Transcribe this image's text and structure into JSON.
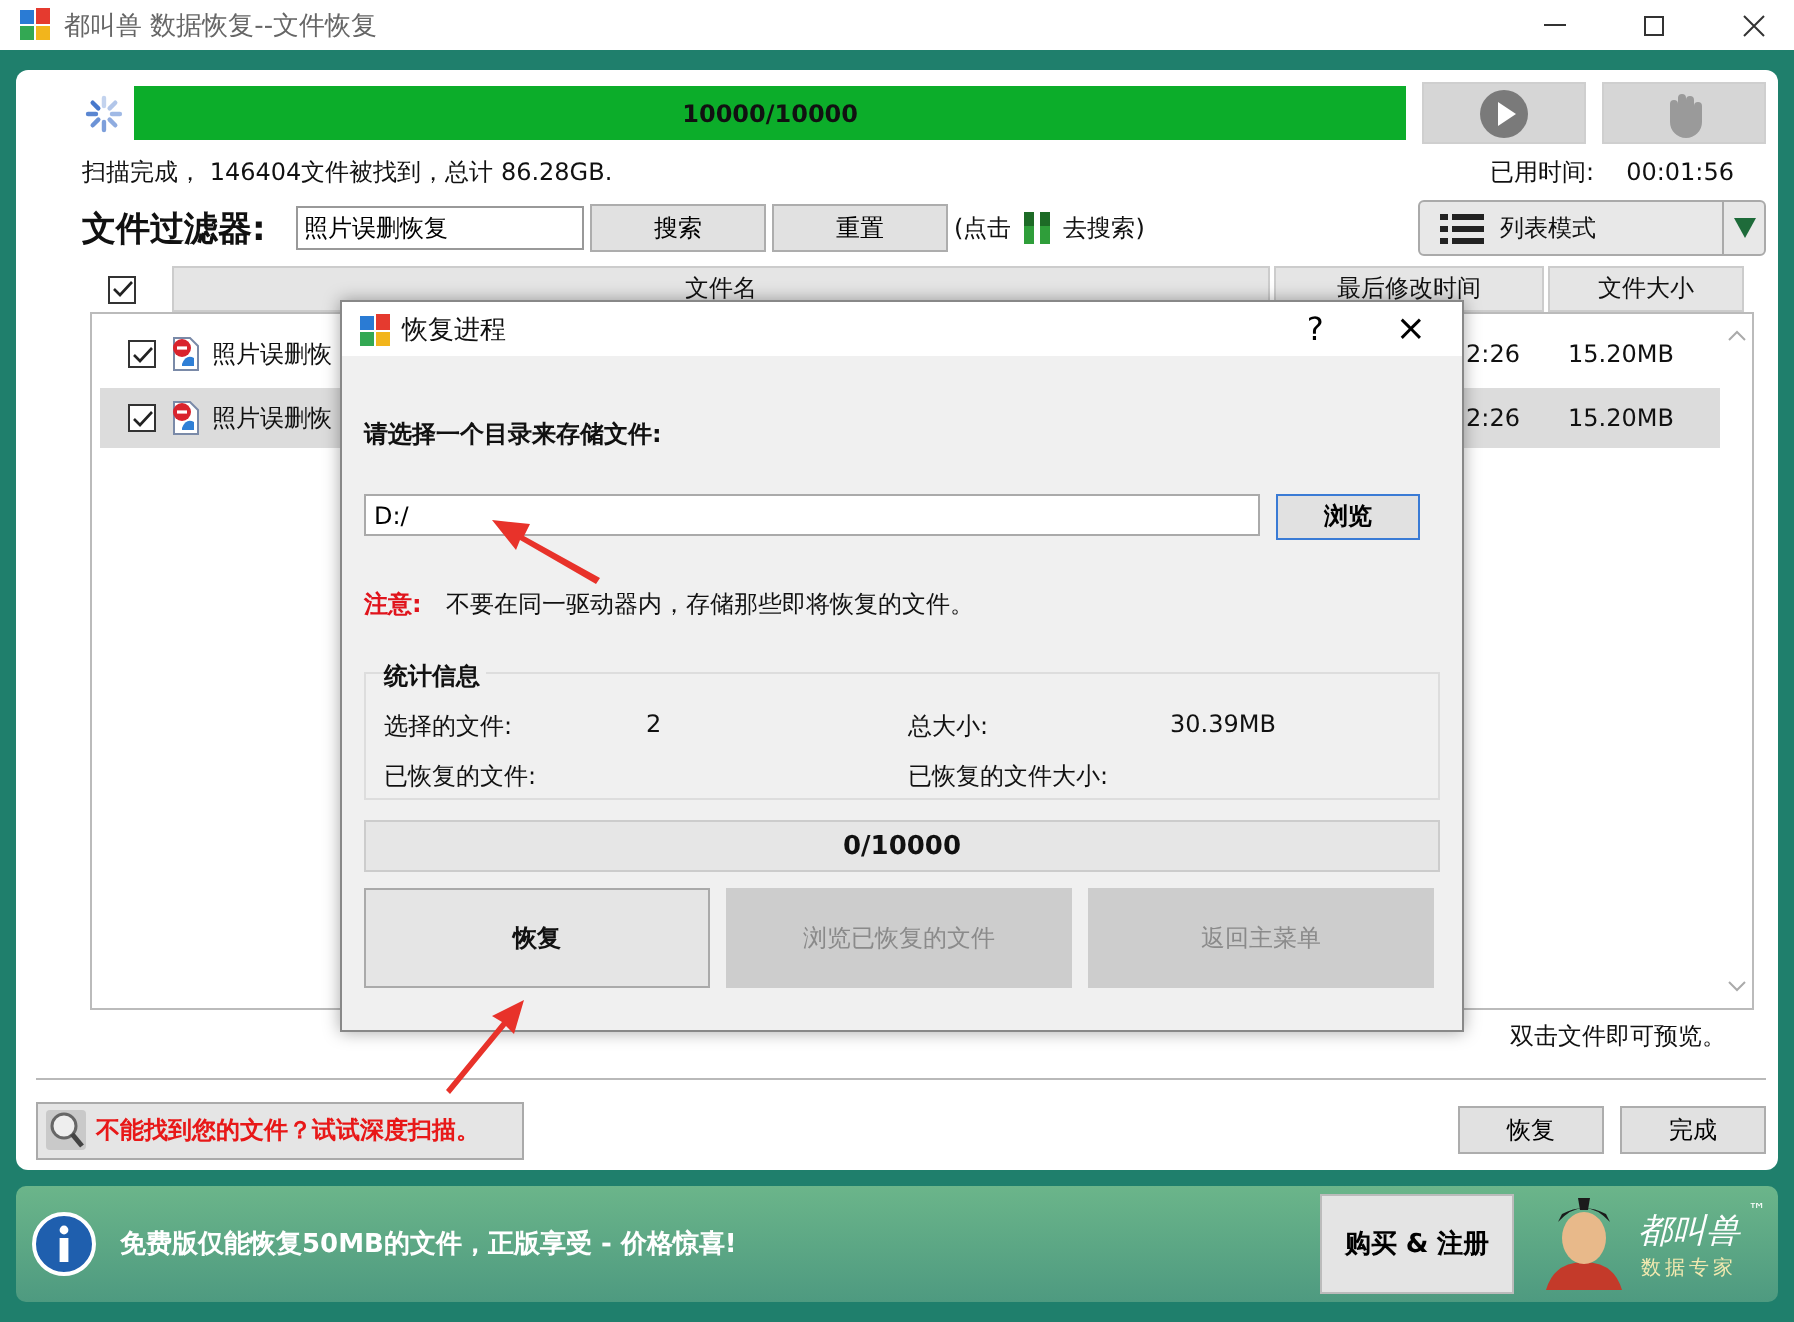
{
  "window": {
    "title": "都叫兽 数据恢复--文件恢复"
  },
  "scan": {
    "level": 1,
    "progress_text": "10000/10000",
    "status": "扫描完成， 146404文件被找到，总计 86.28GB.",
    "elapsed_label": "已用时间:",
    "elapsed": "00:01:56"
  },
  "filter": {
    "label": "文件过滤器:",
    "value": "照片误删恢复",
    "buttons": [
      "搜索",
      "重置"
    ],
    "hint_before": "(点击",
    "hint_after": "去搜索)",
    "view_mode": "列表模式"
  },
  "table": {
    "header_checked": true,
    "columns": [
      "文件名",
      "最后修改时间",
      "文件大小"
    ],
    "rows": [
      {
        "checked": true,
        "selected": false,
        "name": "照片误删恢",
        "time": "2:26",
        "size": "15.20MB"
      },
      {
        "checked": true,
        "selected": true,
        "name": "照片误删恢",
        "time": "2:26",
        "size": "15.20MB"
      }
    ]
  },
  "preview_hint": "双击文件即可预览。",
  "deep_scan": "不能找到您的文件？试试深度扫描。",
  "footer_buttons": [
    "恢复",
    "完成"
  ],
  "ad": {
    "text": "免费版仅能恢复50MB的文件，正版享受 - 价格惊喜!",
    "button": "购买 & 注册",
    "logo_title": "都叫兽",
    "logo_sub": "数据专家",
    "logo_mark": "™"
  },
  "dialog": {
    "title": "恢复进程",
    "help": "?",
    "close": "×",
    "prompt": "请选择一个目录来存储文件:",
    "path": "D:/",
    "browse": "浏览",
    "note_label": "注意:",
    "note": "不要在同一驱动器内，存储那些即将恢复的文件。",
    "stats_title": "统计信息",
    "stats": [
      {
        "label": "选择的文件:",
        "value": "2"
      },
      {
        "label": "总大小:",
        "value": "30.39MB"
      },
      {
        "label": "已恢复的文件:"
      },
      {
        "label": "已恢复的文件大小:"
      }
    ],
    "progress": {
      "level": 0,
      "text": "0/10000"
    },
    "buttons": [
      {
        "label": "恢复",
        "disabled": false
      },
      {
        "label": "浏览已恢复的文件",
        "disabled": true
      },
      {
        "label": "返回主菜单",
        "disabled": true
      }
    ]
  }
}
